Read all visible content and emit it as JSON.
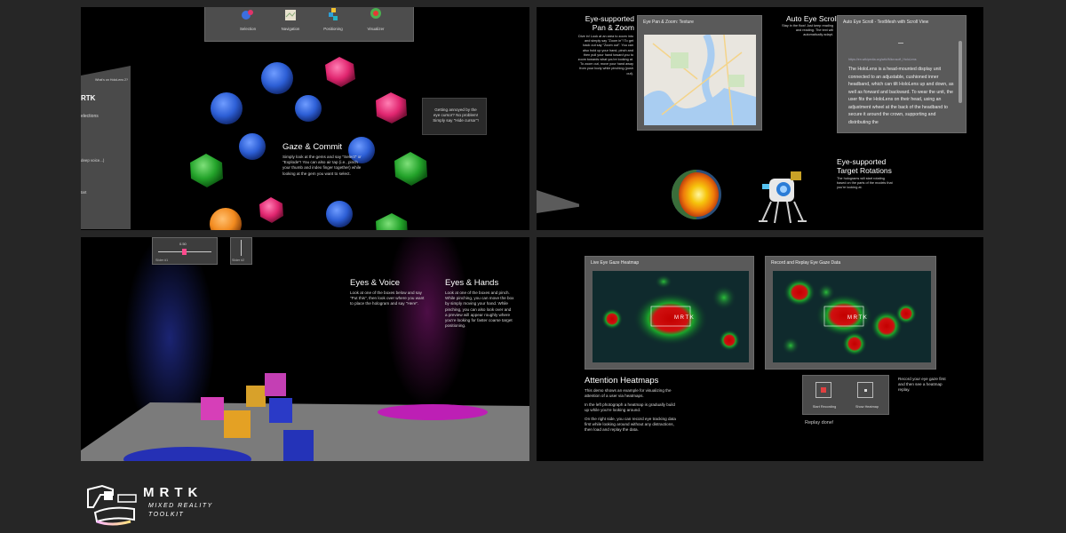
{
  "gaze": {
    "toolbar": [
      {
        "label": "Selection",
        "icon": "selection-icon"
      },
      {
        "label": "Navigation",
        "icon": "navigation-icon"
      },
      {
        "label": "Positioning",
        "icon": "positioning-icon"
      },
      {
        "label": "Visualizer",
        "icon": "visualizer-icon"
      }
    ],
    "side_panel": {
      "header": "What's on HoloLens 2?",
      "title": "RTK",
      "line1": "elections",
      "line2": "deep voice...)",
      "line3": "tart"
    },
    "title": "Gaze & Commit",
    "body": "Simply look at the gems and say \"Select\" or \"Explode\"! You can also air tap (i.e., pinch your thumb and index finger together) while looking at the gem you want to select.",
    "hint": "Getting annoyed by the eye cursor? No problem! Simply say \"Hide cursor\"!"
  },
  "navigation": {
    "pan_title": "Eye-supported Pan & Zoom",
    "pan_body": "Dive in! Look at an area to zoom into and simply say \"Zoom in\"! To get back out say \"Zoom out\". You can also hold up your hand, pinch and then pull your hand toward you to zoom towards what you're looking at. To zoom out, move your hand away from your body while pinching (push out).",
    "pan_window": "Eye Pan & Zoom: Texture",
    "scroll_title": "Auto Eye Scroll",
    "scroll_body": "Stay in the flow! Just keep reading and reading. The text will automatically adapt.",
    "scroll_window": "Auto Eye Scroll - TextMesh with Scroll View",
    "scroll_text": "The HoloLens is a head-mounted display unit connected to an adjustable, cushioned inner headband, which can tilt HoloLens up and down, as well as forward and backward. To wear the unit, the user fits the HoloLens on their head, using an adjustment wheel at the back of the headband to secure it around the crown, supporting and distributing the",
    "scroll_link": "https://en.wikipedia.org/wiki/Microsoft_HoloLens",
    "rot_title": "Eye-supported Target Rotations",
    "rot_body": "The holograms will start rotating based on the parts of the models that you're looking at."
  },
  "positioning": {
    "slider1_value": "0.50",
    "slider1_label": "Slider #1",
    "slider2_label": "Slider #2",
    "voice_title": "Eyes & Voice",
    "voice_body": "Look at one of the boxes below and say \"Put this\", then look over where you want to place the hologram and say \"Here\".",
    "hands_title": "Eyes & Hands",
    "hands_body": "Look at one of the boxes and pinch. While pinching, you can move the box by simply moving your hand. While pinching, you can also look over and a preview will appear roughly where you're looking for faster coarse target positioning."
  },
  "visualizer": {
    "live_window": "Live Eye Gaze Heatmap",
    "replay_window": "Record and Replay Eye Gaze Data",
    "title": "Attention Heatmaps",
    "p1": "This demo shows an example for visualizing the attention of a user via heatmaps.",
    "p2": "In the left photograph a heatmap is gradually build up while you're looking around.",
    "p3": "On the right side, you can record eye tracking data first while looking around without any distractions, then load and replay the data.",
    "start_recording": "Start Recording",
    "show_heatmap": "Show Heatmap",
    "replay_status": "Replay done!",
    "record_hint": "Record your eye gaze first and then see a heatmap replay."
  },
  "brand": {
    "title": "MRTK",
    "subtitle_line1": "MIXED REALITY",
    "subtitle_line2": "TOOLKIT",
    "sign_text": "M R T K",
    "sign_sub": "MIXED REALITY"
  }
}
